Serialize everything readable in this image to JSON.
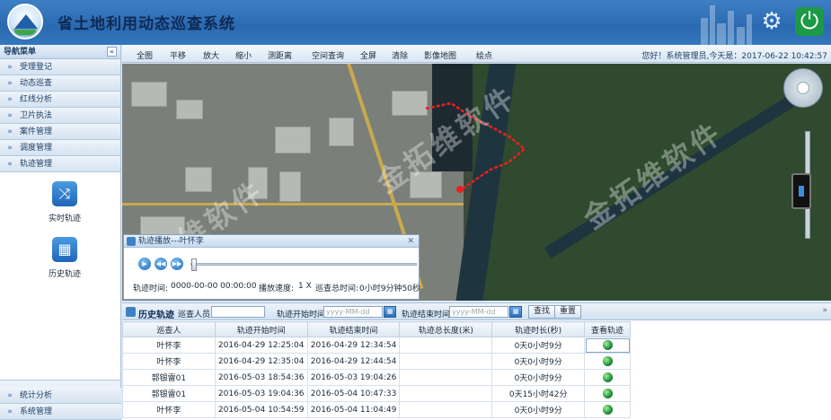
{
  "app": {
    "title": "省土地利用动态巡查系统"
  },
  "nav": {
    "header": "导航菜单",
    "items": [
      {
        "label": "受理登记"
      },
      {
        "label": "动态巡查"
      },
      {
        "label": "红线分析"
      },
      {
        "label": "卫片执法"
      },
      {
        "label": "案件管理"
      },
      {
        "label": "调度管理"
      },
      {
        "label": "轨迹管理"
      }
    ],
    "sub": [
      {
        "label": "实时轨迹"
      },
      {
        "label": "历史轨迹"
      }
    ],
    "bottom": [
      {
        "label": "统计分析"
      },
      {
        "label": "系统管理"
      }
    ]
  },
  "toolbar": {
    "buttons": [
      "全图",
      "平移",
      "放大",
      "缩小",
      "测距离",
      "空间查询",
      "全屏",
      "清除",
      "影像地图",
      "绘点"
    ],
    "greeting": "您好！系统管理员,今天是：2017-06-22 10:42:57"
  },
  "map": {
    "watermark": "金拓维软件"
  },
  "playback": {
    "title": "轨迹播放---叶怀李",
    "track_time_label": "轨迹时间:",
    "track_time_value": "0000-00-00 00:00:00",
    "speed_label": "播放速度:",
    "speed_value": "1 X",
    "total_label": "巡查总时间:",
    "total_value": "0小时9分钟50秒",
    "progress": 0
  },
  "history": {
    "title": "历史轨迹",
    "inspector_label": "巡查人员:",
    "start_label": "轨迹开始时间:",
    "end_label": "轨迹结束时间:",
    "date_placeholder": "yyyy-MM-dd",
    "search_btn": "查找",
    "reset_btn": "重置",
    "columns": [
      "巡查人",
      "轨迹开始时间",
      "轨迹结束时间",
      "轨迹总长度(米)",
      "轨迹时长(秒)",
      "查看轨迹"
    ],
    "rows": [
      {
        "name": "叶怀李",
        "start": "2016-04-29 12:25:04",
        "end": "2016-04-29 12:34:54",
        "len": "",
        "dur": "0天0小时9分"
      },
      {
        "name": "叶怀李",
        "start": "2016-04-29 12:35:04",
        "end": "2016-04-29 12:44:54",
        "len": "",
        "dur": "0天0小时9分"
      },
      {
        "name": "郭银雷01",
        "start": "2016-05-03 18:54:36",
        "end": "2016-05-03 19:04:26",
        "len": "",
        "dur": "0天0小时9分"
      },
      {
        "name": "郭银雷01",
        "start": "2016-05-03 19:04:36",
        "end": "2016-05-04 10:47:33",
        "len": "",
        "dur": "0天15小时42分"
      },
      {
        "name": "叶怀李",
        "start": "2016-05-04 10:54:59",
        "end": "2016-05-04 11:04:49",
        "len": "",
        "dur": "0天0小时9分"
      }
    ]
  }
}
